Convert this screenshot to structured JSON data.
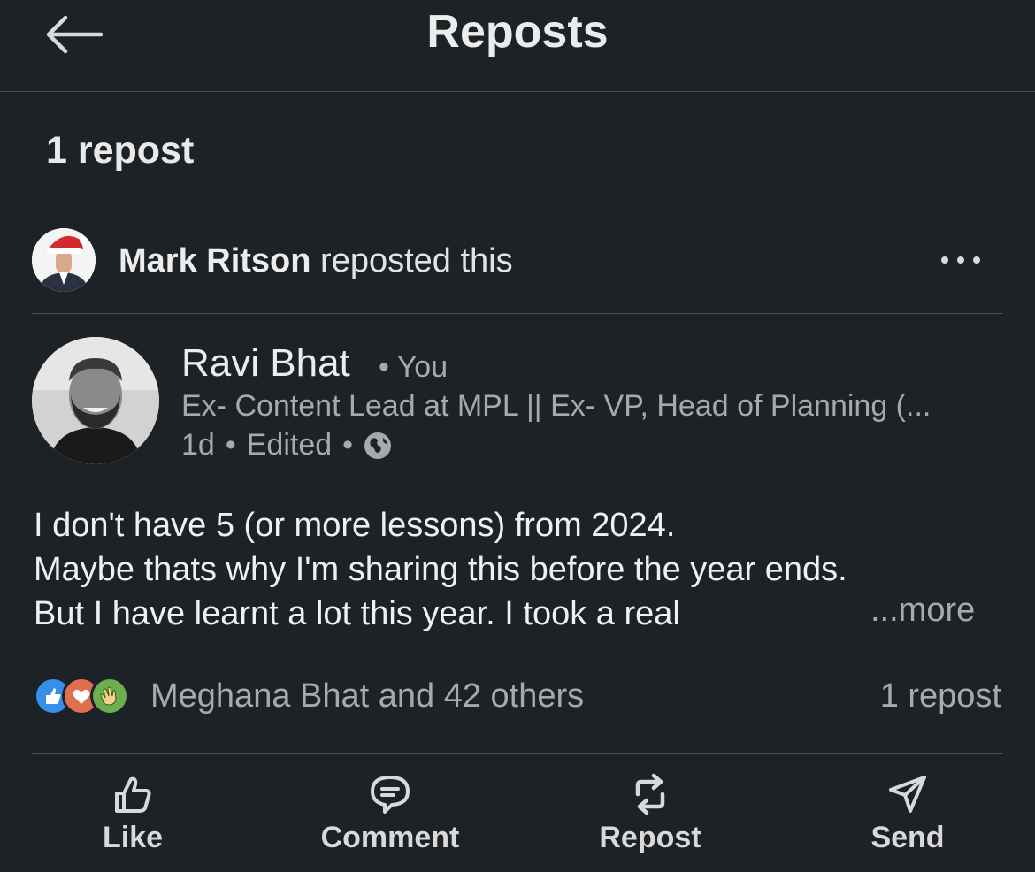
{
  "header": {
    "title": "Reposts",
    "back_icon": "arrow-left-icon"
  },
  "repost_count_label": "1 repost",
  "reposter": {
    "name": "Mark Ritson",
    "action": "reposted this",
    "more_icon": "more-horizontal-icon"
  },
  "post": {
    "author_name": "Ravi Bhat",
    "author_badge": "• You",
    "headline": "Ex- Content Lead at MPL || Ex- VP, Head of Planning (...",
    "time": "1d",
    "edited": "Edited",
    "visibility_icon": "globe-icon",
    "body_lines": [
      "I don't have 5 (or more lessons) from 2024.",
      "Maybe thats why I'm sharing this before the year ends.",
      "But I have learnt a lot this year. I took a real"
    ],
    "see_more": "...more",
    "reactions_text": "Meghana Bhat and 42 others",
    "reposts_text": "1 repost"
  },
  "actions": [
    {
      "label": "Like",
      "icon": "thumbs-up-icon"
    },
    {
      "label": "Comment",
      "icon": "comment-icon"
    },
    {
      "label": "Repost",
      "icon": "repost-icon"
    },
    {
      "label": "Send",
      "icon": "send-icon"
    }
  ],
  "colors": {
    "background": "#1d2226",
    "divider": "#4a4f54",
    "like_blue": "#378fe9",
    "love_red": "#df704d",
    "celebrate_green": "#44712e"
  }
}
